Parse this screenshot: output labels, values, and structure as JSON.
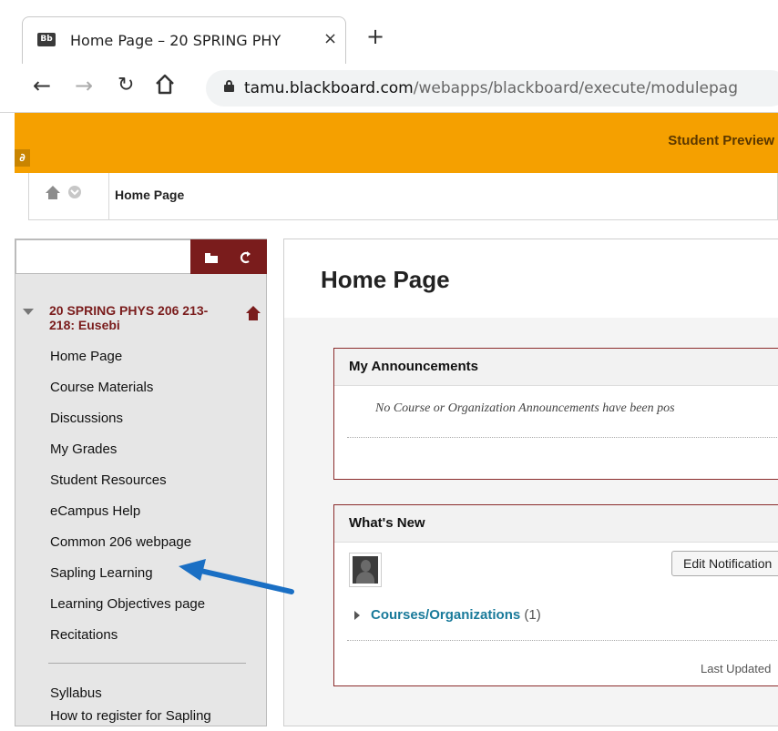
{
  "browser": {
    "tab_title": "Home Page – 20 SPRING PHY",
    "favicon": "Bb",
    "tab_close": "×",
    "new_tab": "+",
    "url_host": "tamu.blackboard.com",
    "url_path": "/webapps/blackboard/execute/modulepag"
  },
  "preview_bar": {
    "label": "Student Preview",
    "icon": "link-icon",
    "color": "#f5a000"
  },
  "breadcrumb": {
    "current": "Home Page"
  },
  "sidebar": {
    "course_title": "20 SPRING PHYS 206 213-218: Eusebi",
    "items": [
      {
        "label": "Home Page"
      },
      {
        "label": "Course Materials"
      },
      {
        "label": "Discussions"
      },
      {
        "label": "My Grades"
      },
      {
        "label": "Student Resources"
      },
      {
        "label": "eCampus Help"
      },
      {
        "label": "Common 206 webpage"
      },
      {
        "label": "Sapling Learning"
      },
      {
        "label": "Learning Objectives page"
      },
      {
        "label": "Recitations"
      }
    ],
    "items2": [
      {
        "label": "Syllabus"
      },
      {
        "label": "How to register for Sapling"
      }
    ],
    "accent": "#7a1c1c"
  },
  "main": {
    "title": "Home Page",
    "announcements": {
      "heading": "My Announcements",
      "empty_text": "No Course or Organization Announcements have been pos"
    },
    "whats_new": {
      "heading": "What's New",
      "edit_button": "Edit Notification",
      "courses_link": "Courses/Organizations",
      "courses_count": "(1)",
      "last_updated": "Last Updated"
    }
  },
  "annotation": {
    "arrow_color": "#1a6fc4"
  }
}
